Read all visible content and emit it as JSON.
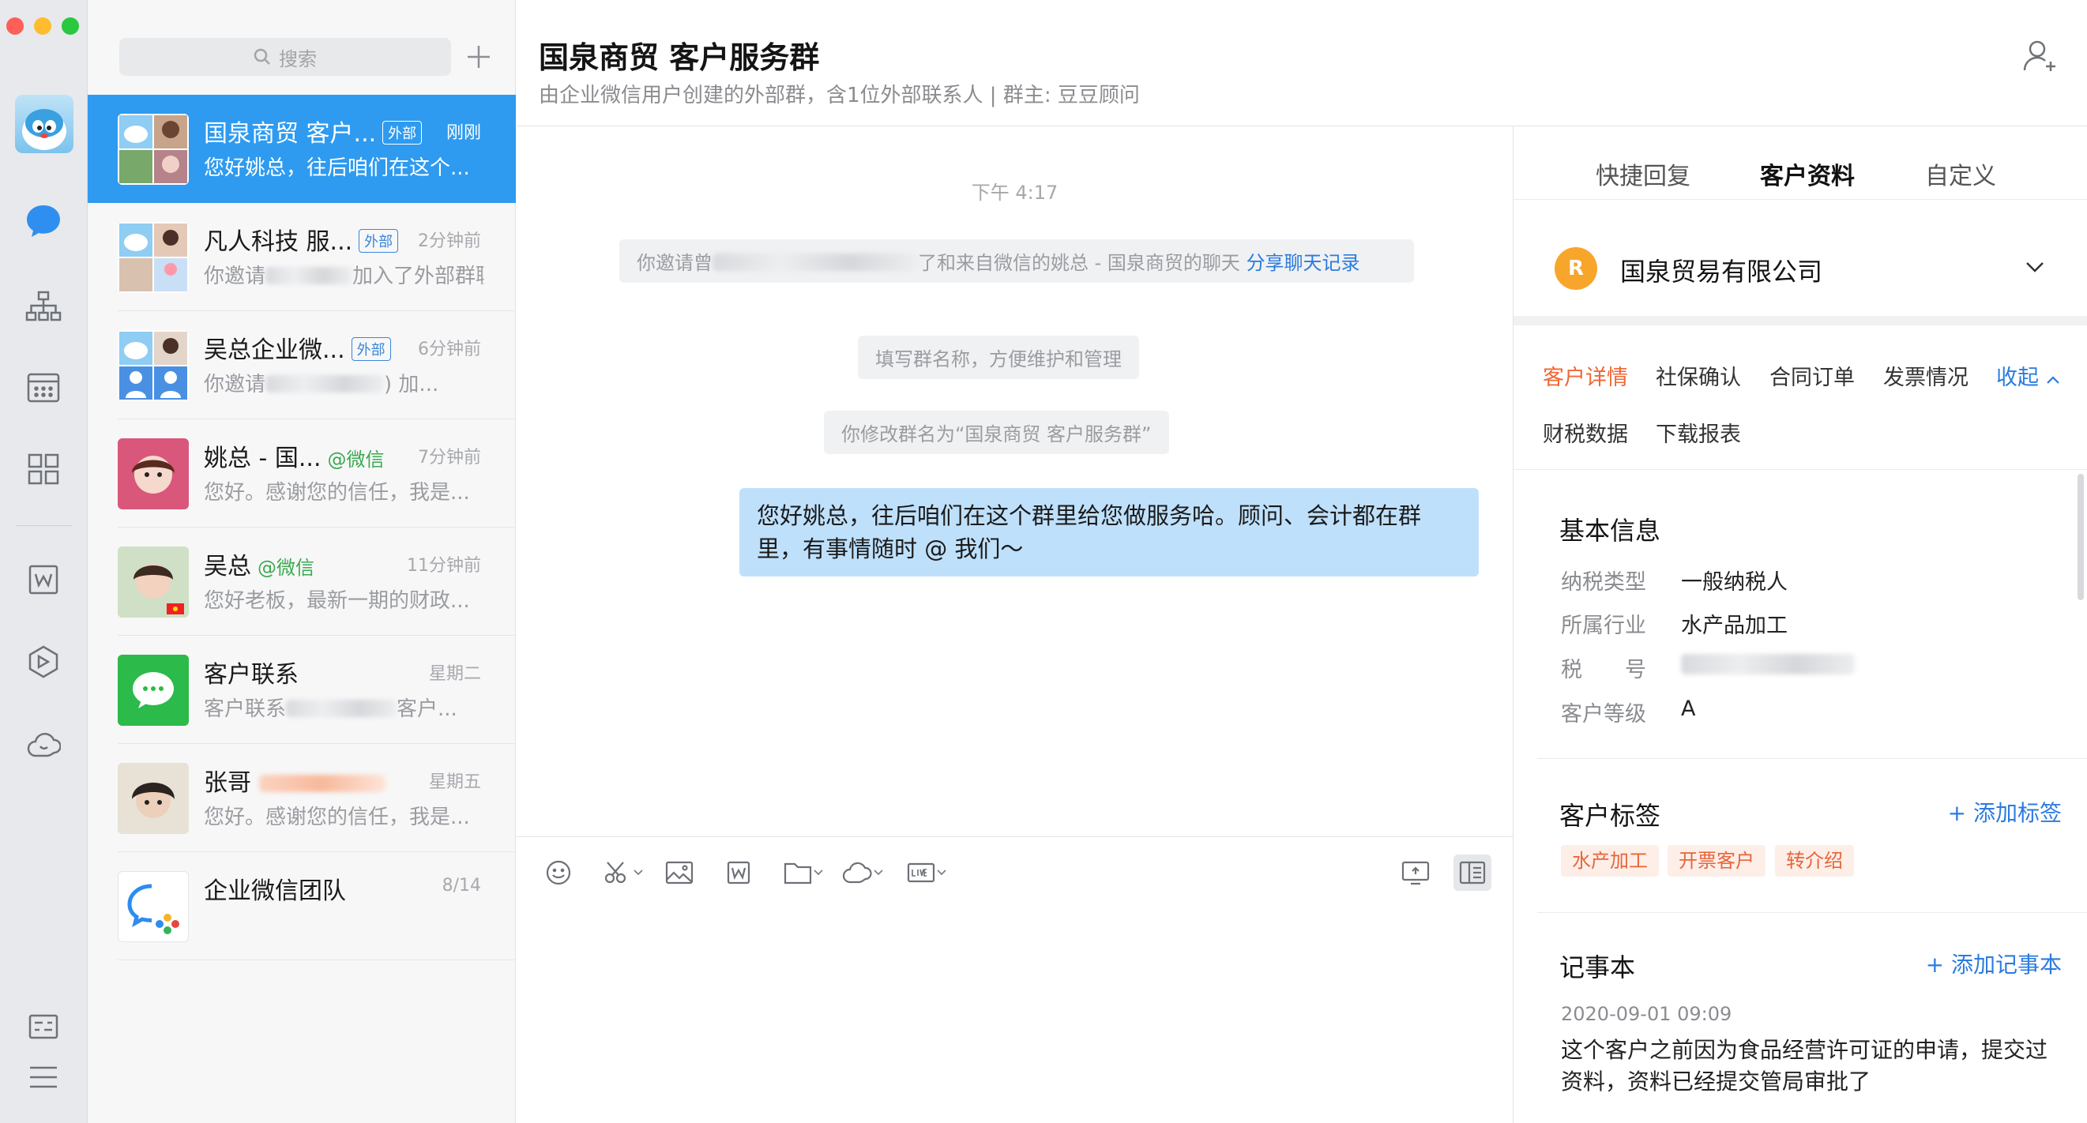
{
  "search": {
    "placeholder": "搜索"
  },
  "conversations": [
    {
      "name": "国泉商贸 客户...",
      "badge": "外部",
      "time": "刚刚",
      "preview": "您好姚总，往后咱们在这个..."
    },
    {
      "name": "凡人科技 服...",
      "badge": "外部",
      "time": "2分钟前",
      "preview_prefix": "你邀请",
      "preview_suffix": "加入了外部群聊"
    },
    {
      "name": "吴总企业微...",
      "badge": "外部",
      "time": "6分钟前",
      "preview_prefix": "你邀请",
      "preview_suffix": ") 加..."
    },
    {
      "name": "姚总 - 国...",
      "wechat": "@微信",
      "time": "7分钟前",
      "preview": "您好。感谢您的信任，我是..."
    },
    {
      "name": "吴总",
      "wechat": "@微信",
      "time": "11分钟前",
      "preview": "您好老板，最新一期的财政..."
    },
    {
      "name": "客户联系",
      "time": "星期二",
      "preview_prefix": "客户联系",
      "preview_suffix": "客户..."
    },
    {
      "name": "张哥",
      "time": "星期五",
      "preview": "您好。感谢您的信任，我是..."
    },
    {
      "name": "企业微信团队",
      "time": "8/14"
    }
  ],
  "chat": {
    "title": "国泉商贸 客户服务群",
    "subtitle": "由企业微信用户创建的外部群，含1位外部联系人 | 群主: 豆豆顾问",
    "time": "下午 4:17",
    "notes": {
      "invite_prefix": "你邀请曾",
      "invite_middle": "了和来自微信的姚总 - 国泉商贸的聊天",
      "invite_link": "分享聊天记录",
      "rename_hint": "填写群名称，方便维护和管理",
      "renamed": "你修改群名为“国泉商贸 客户服务群”"
    },
    "message": "您好姚总，往后咱们在这个群里给您做服务哈。顾问、会计都在群里，有事情随时 @ 我们～"
  },
  "panel": {
    "tabs": [
      "快捷回复",
      "客户资料",
      "自定义"
    ],
    "active_tab": "客户资料",
    "company": {
      "logo": "R",
      "name": "国泉贸易有限公司"
    },
    "subtabs": [
      "客户详情",
      "社保确认",
      "合同订单",
      "发票情况",
      "收起",
      "财税数据",
      "下载报表"
    ],
    "basic": {
      "title": "基本信息",
      "fields": [
        {
          "label": "纳税类型",
          "value": "一般纳税人"
        },
        {
          "label": "所属行业",
          "value": "水产品加工"
        },
        {
          "label": "税　　号",
          "value": ""
        },
        {
          "label": "客户等级",
          "value": "A"
        }
      ]
    },
    "tags": {
      "title": "客户标签",
      "add": "+ 添加标签",
      "items": [
        "水产加工",
        "开票客户",
        "转介绍"
      ]
    },
    "notebook": {
      "title": "记事本",
      "add": "+ 添加记事本",
      "date": "2020-09-01 09:09",
      "text": "这个客户之前因为食品经营许可证的申请，提交过资料，资料已经提交管局审批了"
    }
  },
  "colors": {
    "accent": "#2e9bf0",
    "bubble": "#bfe0fb",
    "tag": "#e8643a",
    "link": "#2b7be0"
  }
}
